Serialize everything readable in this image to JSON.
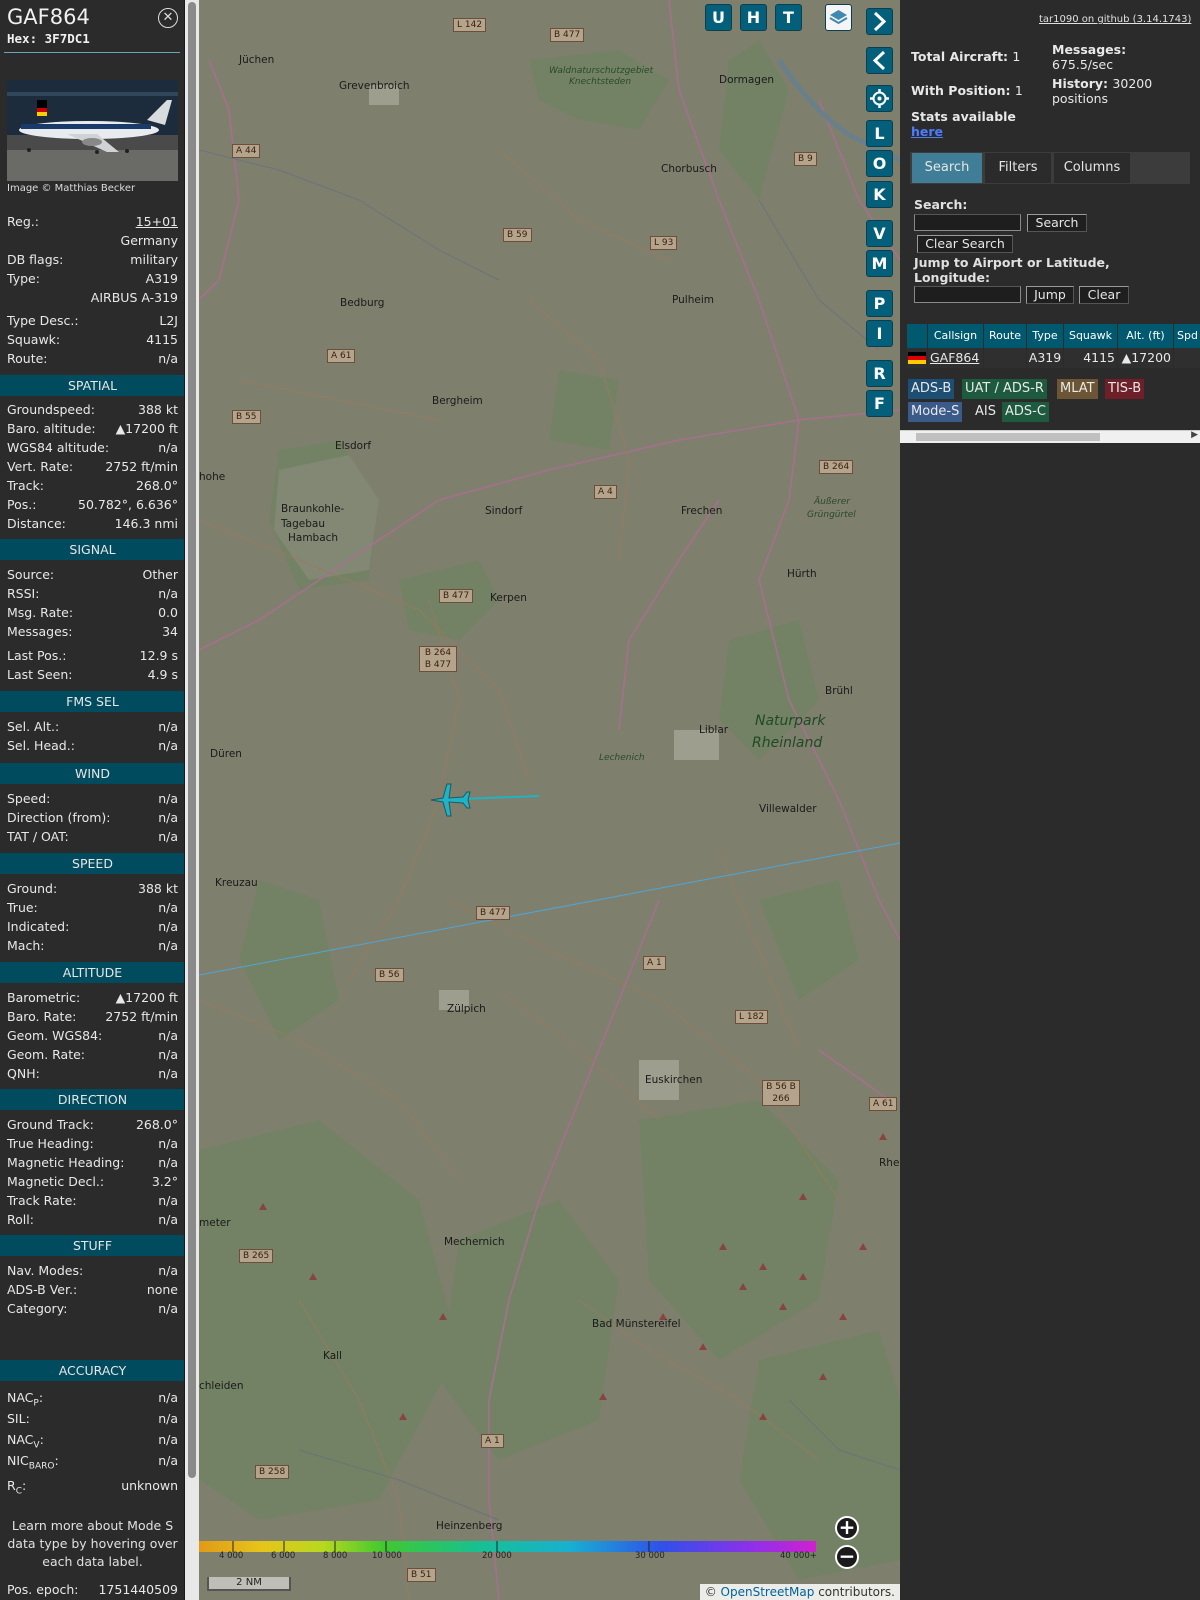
{
  "sidebar": {
    "callsign": "GAF864",
    "hex_label": "Hex:",
    "hex": "3F7DC1",
    "photo_credit": "Image © Matthias Becker",
    "reg": {
      "label": "Reg.:",
      "value": "15+01"
    },
    "country": "Germany",
    "db_flags": {
      "label": "DB flags:",
      "value": "military"
    },
    "type": {
      "label": "Type:",
      "value": "A319"
    },
    "type_name": "AIRBUS A-319",
    "type_desc": {
      "label": "Type Desc.:",
      "value": "L2J"
    },
    "squawk": {
      "label": "Squawk:",
      "value": "4115"
    },
    "route": {
      "label": "Route:",
      "value": "n/a"
    },
    "spatial": {
      "title": "SPATIAL",
      "rows": [
        {
          "label": "Groundspeed:",
          "value": "388 kt"
        },
        {
          "label": "Baro. altitude:",
          "value": "▲17200 ft"
        },
        {
          "label": "WGS84 altitude:",
          "value": "n/a"
        },
        {
          "label": "Vert. Rate:",
          "value": "2752 ft/min"
        },
        {
          "label": "Track:",
          "value": "268.0°"
        },
        {
          "label": "Pos.:",
          "value": "50.782°, 6.636°"
        },
        {
          "label": "Distance:",
          "value": "146.3 nmi"
        }
      ]
    },
    "signal": {
      "title": "SIGNAL",
      "rows": [
        {
          "label": "Source:",
          "value": "Other"
        },
        {
          "label": "RSSI:",
          "value": "n/a"
        },
        {
          "label": "Msg. Rate:",
          "value": "0.0"
        },
        {
          "label": "Messages:",
          "value": "34"
        },
        {
          "label": "Last Pos.:",
          "value": "12.9 s"
        },
        {
          "label": "Last Seen:",
          "value": "4.9 s"
        }
      ]
    },
    "fms": {
      "title": "FMS SEL",
      "rows": [
        {
          "label": "Sel. Alt.:",
          "value": "n/a"
        },
        {
          "label": "Sel. Head.:",
          "value": "n/a"
        }
      ]
    },
    "wind": {
      "title": "WIND",
      "rows": [
        {
          "label": "Speed:",
          "value": "n/a"
        },
        {
          "label": "Direction (from):",
          "value": "n/a"
        },
        {
          "label": "TAT / OAT:",
          "value": "n/a"
        }
      ]
    },
    "speed": {
      "title": "SPEED",
      "rows": [
        {
          "label": "Ground:",
          "value": "388 kt"
        },
        {
          "label": "True:",
          "value": "n/a"
        },
        {
          "label": "Indicated:",
          "value": "n/a"
        },
        {
          "label": "Mach:",
          "value": "n/a"
        }
      ]
    },
    "altitude": {
      "title": "ALTITUDE",
      "rows": [
        {
          "label": "Barometric:",
          "value": "▲17200 ft"
        },
        {
          "label": "Baro. Rate:",
          "value": "2752 ft/min"
        },
        {
          "label": "Geom. WGS84:",
          "value": "n/a"
        },
        {
          "label": "Geom. Rate:",
          "value": "n/a"
        },
        {
          "label": "QNH:",
          "value": "n/a"
        }
      ]
    },
    "direction": {
      "title": "DIRECTION",
      "rows": [
        {
          "label": "Ground Track:",
          "value": "268.0°"
        },
        {
          "label": "True Heading:",
          "value": "n/a"
        },
        {
          "label": "Magnetic Heading:",
          "value": "n/a"
        },
        {
          "label": "Magnetic Decl.:",
          "value": "3.2°"
        },
        {
          "label": "Track Rate:",
          "value": "n/a"
        },
        {
          "label": "Roll:",
          "value": "n/a"
        }
      ]
    },
    "stuff": {
      "title": "STUFF",
      "rows": [
        {
          "label": "Nav. Modes:",
          "value": "n/a"
        },
        {
          "label": "ADS-B Ver.:",
          "value": "none"
        },
        {
          "label": "Category:",
          "value": "n/a"
        }
      ]
    },
    "accuracy": {
      "title": "ACCURACY",
      "nacp": {
        "base": "NAC",
        "sub": "P",
        "suffix": ":",
        "value": "n/a"
      },
      "sil": {
        "label": "SIL:",
        "value": "n/a"
      },
      "nacv": {
        "base": "NAC",
        "sub": "V",
        "suffix": ":",
        "value": "n/a"
      },
      "nicbaro": {
        "base": "NIC",
        "sub": "BARO",
        "suffix": ":",
        "value": "n/a"
      },
      "rc": {
        "base": "R",
        "sub": "C",
        "suffix": ":",
        "value": "unknown"
      }
    },
    "learn_more": "Learn more about Mode S data type by hovering over each data label.",
    "pos_epoch": {
      "label": "Pos. epoch:",
      "value": "1751440509"
    }
  },
  "map": {
    "buttons": [
      "U",
      "H",
      "T"
    ],
    "side_buttons": [
      "L",
      "O",
      "K",
      "V",
      "M",
      "P",
      "I",
      "R",
      "F"
    ],
    "zoom_in": "+",
    "zoom_out": "−",
    "scale": "2 NM",
    "legend_ticks": [
      "4 000",
      "6 000",
      "8 000",
      "10 000",
      "20 000",
      "30 000",
      "40 000+"
    ],
    "attribution_prefix": "© ",
    "attribution_link": "OpenStreetMap",
    "attribution_suffix": " contributors.",
    "places": [
      "Jüchen",
      "Grevenbroich",
      "Dormagen",
      "Waldnaturschutzgebiet",
      "Knechtsteden",
      "Chorbusch",
      "Bedburg",
      "Pulheim",
      "Bergheim",
      "Elsdorf",
      "Braunkohle-",
      "Tagebau",
      "Hambach",
      "Sindorf",
      "Frechen",
      "Äußerer",
      "Grüngürtel",
      "Hürth",
      "Kerpen",
      "Brühl",
      "Naturpark",
      "Rheinland",
      "Liblar",
      "Lechenich",
      "Düren",
      "Villewalder",
      "Kreuzau",
      "Zülpich",
      "Euskirchen",
      "Mechernich",
      "Bad Münstereifel",
      "Kall",
      "chleiden",
      "Heinzenberg",
      "Rhe",
      "meter",
      "hohe"
    ],
    "roads": [
      "L 142",
      "B 477",
      "A 44",
      "B 59",
      "L 93",
      "B 9",
      "A 61",
      "B 55",
      "A 4",
      "B 264",
      "B 477",
      "B 264 B 477",
      "B 477",
      "B 56",
      "A 1",
      "L 182",
      "B 56 B 266",
      "A 61",
      "B 265",
      "A 1",
      "B 258",
      "B 51"
    ]
  },
  "panel": {
    "github": "tar1090 on github (3.14.1743)",
    "total_label": "Total Aircraft:",
    "total_value": "1",
    "with_pos_label": "With Position:",
    "with_pos_value": "1",
    "messages_label": "Messages:",
    "messages_value": "675.5/sec",
    "history_label": "History:",
    "history_value": "30200 positions",
    "stats_label": "Stats available",
    "stats_link": "here",
    "tabs": [
      "Search",
      "Filters",
      "Columns"
    ],
    "search_label": "Search:",
    "search_button": "Search",
    "clear_search_button": "Clear Search",
    "jump_label": "Jump to Airport or Latitude, Longitude:",
    "jump_button": "Jump",
    "clear_button": "Clear",
    "table": {
      "columns": [
        "Callsign",
        "Route",
        "Type",
        "Squawk",
        "Alt. (ft)",
        "Spd"
      ],
      "row": {
        "callsign": "GAF864",
        "route": "",
        "type": "A319",
        "squawk": "4115",
        "alt": "▲17200"
      }
    },
    "badges": [
      "ADS-B",
      "UAT / ADS-R",
      "MLAT",
      "TIS-B",
      "Mode-S",
      "AIS",
      "ADS-C"
    ]
  }
}
